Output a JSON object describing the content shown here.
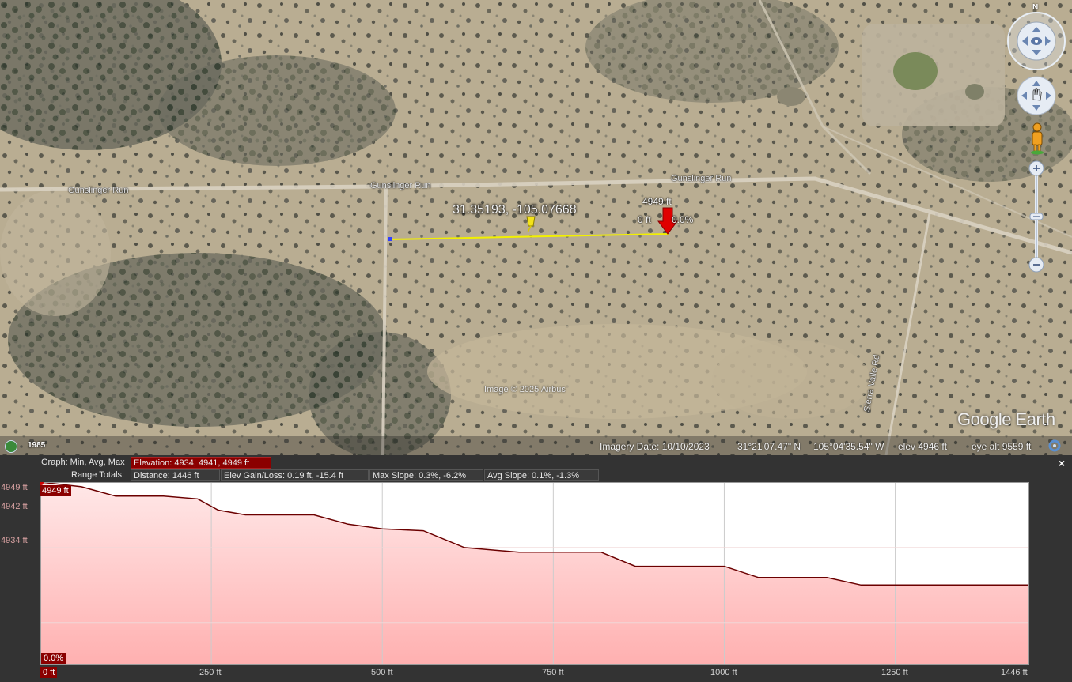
{
  "map": {
    "road_labels": [
      "Gunslinger Run",
      "Gunslinger Run",
      "Gunslinger Run",
      "Sierra Valle Rd"
    ],
    "coord_label": "31.35193, -105.07668",
    "marker": {
      "elev": "4949 ft",
      "dist": "0 ft",
      "slope": "0.0%"
    },
    "credit": "Image © 2025 Airbus",
    "logo": "Google Earth",
    "history_year": "1985",
    "compass_letter": "N",
    "icons": [
      "compass-icon",
      "look-joystick-icon",
      "move-joystick-icon",
      "street-view-pegman-icon",
      "zoom-in-icon",
      "zoom-out-icon",
      "history-clock-icon",
      "loading-icon"
    ]
  },
  "status": {
    "imagery_date": "Imagery Date: 10/10/2023",
    "lat": "31°21'07.47\" N",
    "lon": "105°04'35.54\" W",
    "elev": "elev  4946 ft",
    "eye_alt": "eye alt   9559 ft"
  },
  "profile": {
    "graph_label": "Graph: Min, Avg, Max",
    "range_label": "Range Totals:",
    "elevation": "Elevation: 4934, 4941, 4949 ft",
    "distance": "Distance: 1446 ft",
    "elev_gain": "Elev Gain/Loss: 0.19 ft, -15.4 ft",
    "max_slope": "Max Slope: 0.3%, -6.2%",
    "avg_slope": "Avg Slope: 0.1%, -1.3%",
    "close_label": "×",
    "top_badge": "4949 ft",
    "bottom_badge": "0.0%"
  },
  "chart_data": {
    "type": "area",
    "title": "",
    "xlabel": "",
    "ylabel": "",
    "x_ticks": [
      "0 ft",
      "250 ft",
      "500 ft",
      "750 ft",
      "1000 ft",
      "1250 ft",
      "1446 ft"
    ],
    "y_ticks": [
      "4949 ft",
      "4942 ft",
      "4934 ft"
    ],
    "xlim": [
      0,
      1446
    ],
    "ylim": [
      4929.5,
      4949
    ],
    "series": [
      {
        "x": [
          0,
          60,
          110,
          180,
          230,
          260,
          300,
          400,
          450,
          500,
          560,
          620,
          700,
          820,
          870,
          1000,
          1050,
          1150,
          1200,
          1300,
          1446
        ],
        "y": [
          4949,
          4948.5,
          4947.5,
          4947.5,
          4947.2,
          4946,
          4945.5,
          4945.5,
          4944.5,
          4944,
          4943.8,
          4942,
          4941.5,
          4941.5,
          4940,
          4940,
          4938.8,
          4938.8,
          4938,
          4938,
          4938
        ]
      }
    ],
    "colors": {
      "line": "#6b0000",
      "fill_top": "#ffe8e8",
      "fill_bottom": "#ffb0b0"
    }
  }
}
